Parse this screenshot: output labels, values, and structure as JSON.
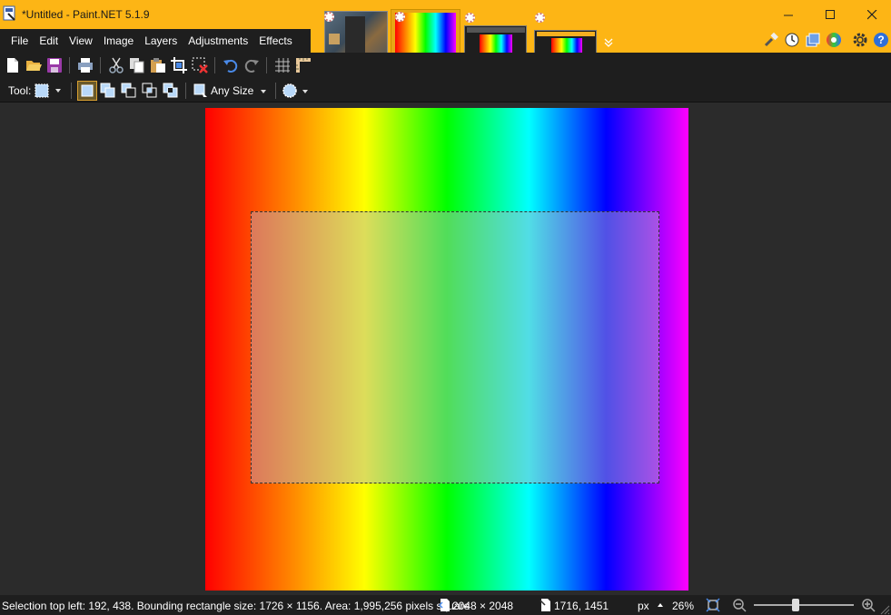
{
  "window": {
    "title": "*Untitled - Paint.NET 5.1.9",
    "minimize_glyph": "—",
    "maximize_glyph": "☐",
    "close_glyph": "✕"
  },
  "menu": {
    "items": [
      "File",
      "Edit",
      "View",
      "Image",
      "Layers",
      "Adjustments",
      "Effects"
    ]
  },
  "toolbar": {
    "tool_label": "Tool:",
    "brush_size_label": "Any Size"
  },
  "status": {
    "selection_info": "Selection top left: 192, 438. Bounding rectangle size: 1726 × 1156. Area: 1,995,256 pixels square",
    "image_size": "2048 × 2048",
    "cursor_position": "1716, 1451",
    "units": "px",
    "zoom": "26%"
  },
  "colors": {
    "accent": "#fdb515",
    "toolbar_bg": "#1e1e1e",
    "workspace_bg": "#2b2b2b"
  },
  "icons": {
    "window": [
      "app-icon",
      "minimize-icon",
      "maximize-icon",
      "close-icon"
    ],
    "right_toolbar": [
      "tools-icon",
      "history-icon",
      "layers-icon",
      "colors-icon",
      "settings-icon",
      "help-icon"
    ],
    "toolbar1": [
      "new-icon",
      "open-icon",
      "save-icon",
      "print-icon",
      "cut-icon",
      "copy-icon",
      "paste-icon",
      "crop-icon",
      "deselect-icon",
      "undo-icon",
      "redo-icon",
      "grid-icon",
      "ruler-icon"
    ],
    "toolbar2": [
      "rectangle-select-icon",
      "selection-mode-replace-icon",
      "selection-mode-union-icon",
      "selection-mode-exclude-icon",
      "selection-mode-intersect-icon",
      "selection-mode-invert-icon",
      "fixed-size-icon",
      "antialias-icon"
    ]
  }
}
